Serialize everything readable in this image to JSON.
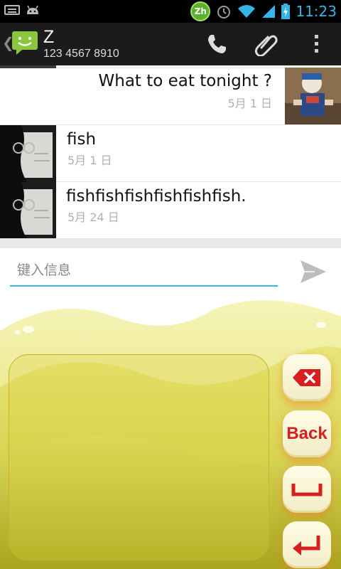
{
  "status_bar": {
    "ime_badge": "Zh",
    "time": "11:23"
  },
  "action_bar": {
    "contact_name": "Z",
    "contact_number": "123 4567 8910",
    "icons": [
      "messaging-app-logo",
      "phone-icon",
      "attach-icon",
      "overflow-menu-icon"
    ]
  },
  "messages": [
    {
      "text": "What to eat tonight ?",
      "date": "5月 1 日",
      "direction": "outgoing"
    },
    {
      "text": "fish",
      "date": "5月 1 日",
      "direction": "incoming"
    },
    {
      "text": "fishfishfishfishfishfish.",
      "date": "5月 24 日",
      "direction": "incoming"
    }
  ],
  "compose": {
    "placeholder": "键入信息",
    "value": ""
  },
  "keyboard": {
    "type": "handwriting",
    "back_label": "Back",
    "keys": [
      "delete-key",
      "back-key",
      "space-key",
      "enter-key"
    ]
  },
  "colors": {
    "accent": "#33b5e5",
    "key_glyph": "#d81e1e",
    "keyboard_theme": "#d4d72f"
  }
}
